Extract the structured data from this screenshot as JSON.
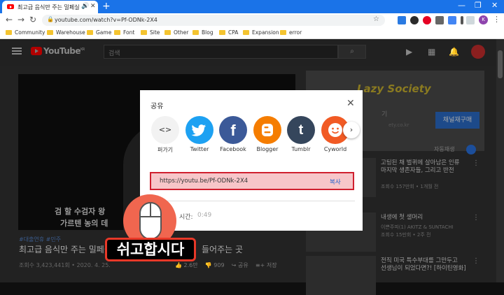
{
  "browser": {
    "tab_title": "최고급 음식만 주는 밀페실",
    "new_tab": "+",
    "address": "youtube.com/watch?v=Pf-ODNk-2X4",
    "bookmarks": [
      "Community",
      "Warehouse",
      "Game",
      "Font",
      "Site",
      "Other",
      "Blog",
      "CPA",
      "Expansion",
      "error"
    ],
    "profile_initial": "K"
  },
  "youtube": {
    "logo_text": "YouTube",
    "logo_region": "KR",
    "search_placeholder": "검색",
    "video": {
      "subtitle_line1": "검 할 수검자 왕",
      "subtitle_line2": "가르텐 농의 데"
    },
    "hashtags": "#대출연휴 #민주",
    "title_left": "최고급 음식만 주는 밀페실",
    "title_right": "들어주는 곳",
    "meta": "조회수 3,423,441회 • 2020. 4. 25.",
    "likes": "2.6만",
    "dislikes": "909",
    "share_label": "공유",
    "save_label": "저장",
    "channel": {
      "banner_text": "Lazy Society",
      "name_fragment": "기",
      "url_fragment": "ety.co.kr",
      "subscribe": "채널재구매",
      "autoplay": "자동재생"
    },
    "recommendations": [
      {
        "title1": "고팅된 채 벌퀴에 살아남은 인류",
        "title2": "마지막 생존자들, 그리고 반전",
        "channel": "",
        "meta": "조회수 157만회 • 1개월 전",
        "duration": ""
      },
      {
        "title1": "내생에 첫 샐머리",
        "title2": "",
        "channel": "이쁜주피(1) AKITZ & SUNTACHI",
        "meta": "조회수 15만회 • 2주 전",
        "duration": ""
      },
      {
        "title1": "전직 미국 특수부대를 그만두고",
        "title2": "선생님이 되었다면?! [하이틴영화]",
        "channel": "",
        "meta": "",
        "duration": ""
      }
    ]
  },
  "share_dialog": {
    "title": "공유",
    "targets": [
      {
        "label": "퍼가기",
        "color": "#f2f2f2",
        "glyph": "<>"
      },
      {
        "label": "Twitter",
        "color": "#1da1f2",
        "glyph": ""
      },
      {
        "label": "Facebook",
        "color": "#3b5998",
        "glyph": "f"
      },
      {
        "label": "Blogger",
        "color": "#f57d00",
        "glyph": ""
      },
      {
        "label": "Tumblr",
        "color": "#35465c",
        "glyph": "t"
      },
      {
        "label": "Cyworld",
        "color": "#f15a24",
        "glyph": ""
      }
    ],
    "link": "https://youtu.be/Pf-ODNk-2X4",
    "copy": "복사",
    "start_time_label": "시간:",
    "start_time_value": "0:49"
  },
  "overlay": {
    "caption": "쉬고합시다"
  }
}
